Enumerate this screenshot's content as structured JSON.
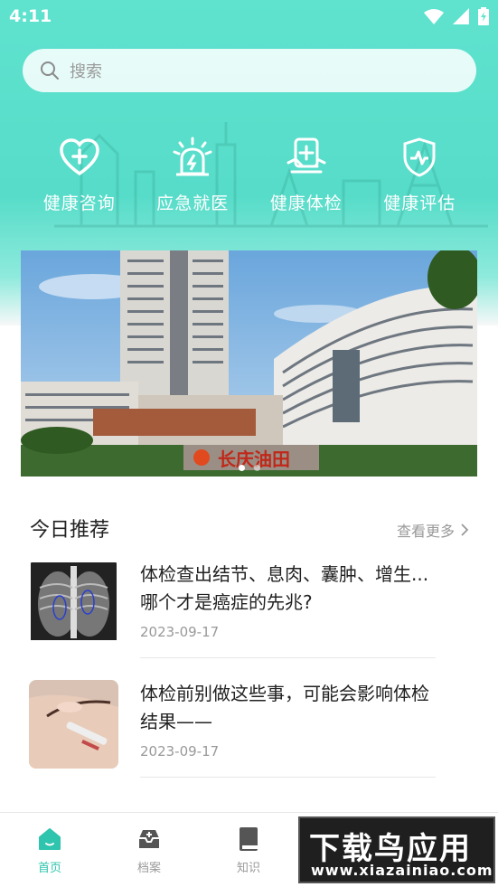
{
  "status": {
    "time": "4:11"
  },
  "search": {
    "placeholder": "搜索"
  },
  "quick_actions": [
    {
      "label": "健康咨询",
      "icon": "heart-plus-icon"
    },
    {
      "label": "应急就医",
      "icon": "emergency-light-icon"
    },
    {
      "label": "健康体检",
      "icon": "medical-checkup-icon"
    },
    {
      "label": "健康评估",
      "icon": "shield-pulse-icon"
    }
  ],
  "banner": {
    "sign_text": "长庆油田",
    "page_count": 2,
    "active_index": 0
  },
  "recommend": {
    "title": "今日推荐",
    "more_label": "查看更多",
    "articles": [
      {
        "title": "体检查出结节、息肉、囊肿、增生...哪个才是癌症的先兆?",
        "date": "2023-09-17",
        "thumb": "chest-xray"
      },
      {
        "title": "体检前别做这些事，可能会影响体检结果——",
        "date": "2023-09-17",
        "thumb": "blood-draw"
      }
    ]
  },
  "tabbar": {
    "items": [
      {
        "label": "首页",
        "icon": "home-icon",
        "active": true
      },
      {
        "label": "档案",
        "icon": "archive-icon",
        "active": false
      },
      {
        "label": "知识",
        "icon": "book-icon",
        "active": false
      }
    ]
  },
  "watermark": {
    "title": "下载鸟应用",
    "url": "www.xiazainiao.com"
  },
  "colors": {
    "accent": "#2ec4ad",
    "header": "#5fe3cf"
  }
}
